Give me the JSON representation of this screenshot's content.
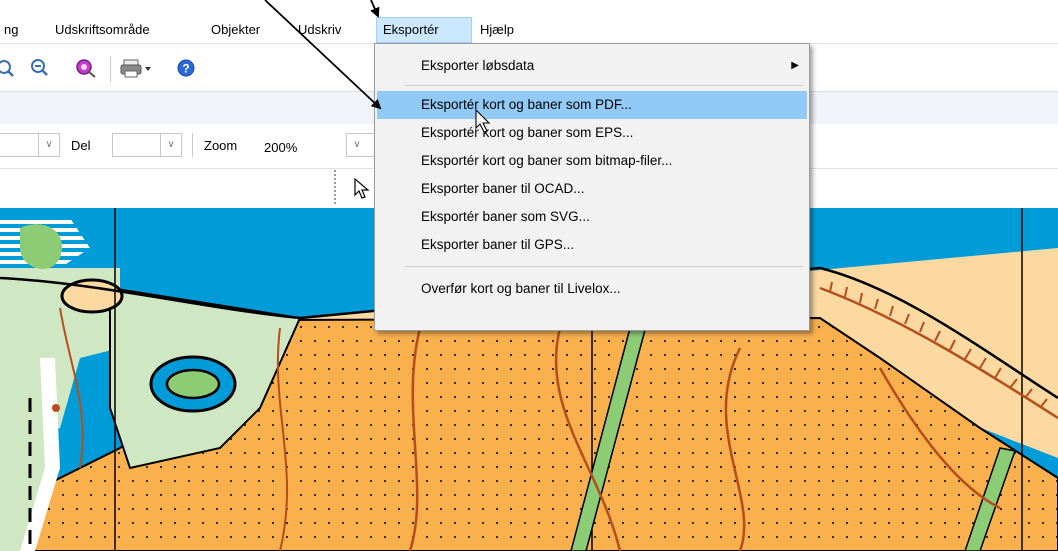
{
  "menubar": {
    "items": [
      "ng",
      "Udskriftsområde",
      "Objekter",
      "Udskriv",
      "Eksportér",
      "Hjælp"
    ],
    "active_index": 4
  },
  "toolbar2": {
    "del_label": "Del",
    "zoom_label": "Zoom",
    "zoom_value": "200%"
  },
  "dropdown": {
    "items": [
      "Eksporter løbsdata",
      "Eksportér kort og baner som PDF...",
      "Eksportér kort og baner som EPS...",
      "Eksportér kort og baner som bitmap-filer...",
      "Eksporter baner til OCAD...",
      "Eksportér baner som SVG...",
      "Eksporter baner til GPS...",
      "Overfør kort og baner til Livelox..."
    ],
    "highlighted_index": 1
  },
  "colors": {
    "menu_active": "#cce8ff",
    "highlight": "#91c9f7",
    "sea": "#009cd9",
    "orange": "#f9b04d",
    "light_green": "#cfe7c3",
    "green": "#8ccc75",
    "sand": "#fcd9a0",
    "brown": "#b54e1b"
  },
  "icons": [
    "zoom-in-icon",
    "zoom-out-icon",
    "special-tool-icon",
    "print-icon",
    "help-icon",
    "pointer-tool-icon",
    "mouse-cursor-icon"
  ]
}
